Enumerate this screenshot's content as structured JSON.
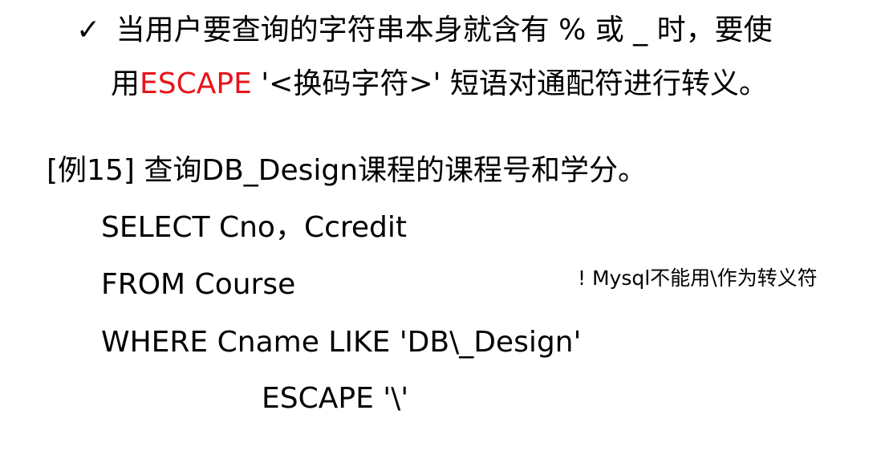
{
  "bullet": {
    "check_icon": "✓",
    "line1": "当用户要查询的字符串本身就含有 % 或 _ 时，要使",
    "line2_pre": "用",
    "line2_keyword": "ESCAPE",
    "line2_post": " '<换码字符>' 短语对通配符进行转义。",
    "keyword_color": "#e8141b"
  },
  "example": {
    "title": "[例15] 查询DB_Design课程的课程号和学分。",
    "sql": [
      "SELECT Cno，Ccredit",
      "FROM Course",
      "WHERE Cname LIKE 'DB\\_Design'",
      "ESCAPE '\\'"
    ]
  },
  "note": "! Mysql不能用\\作为转义符"
}
